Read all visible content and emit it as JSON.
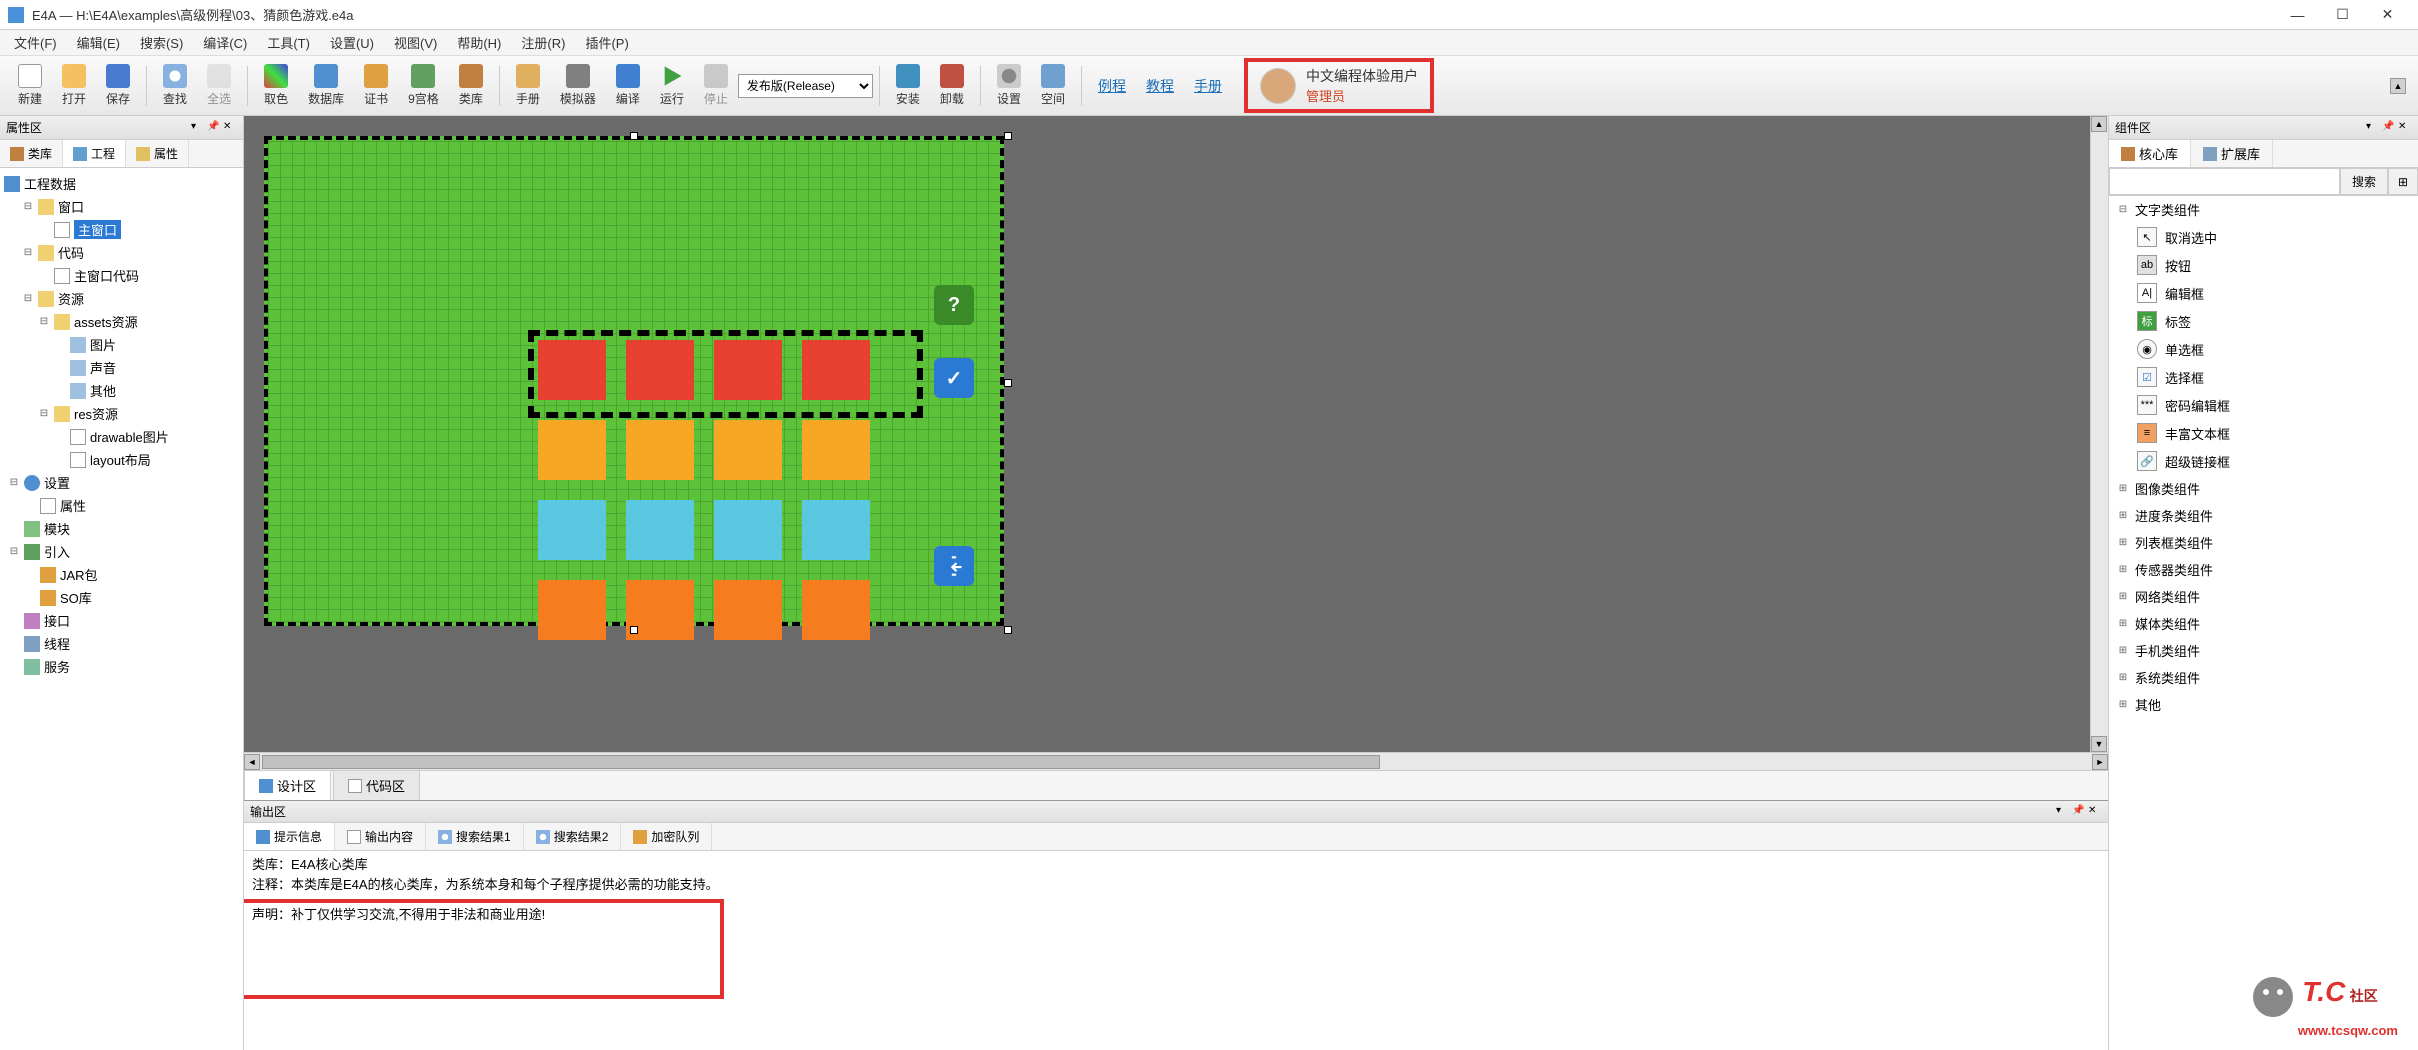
{
  "title": "E4A — H:\\E4A\\examples\\高级例程\\03、猜颜色游戏.e4a",
  "menu": [
    "文件(F)",
    "编辑(E)",
    "搜索(S)",
    "编译(C)",
    "工具(T)",
    "设置(U)",
    "视图(V)",
    "帮助(H)",
    "注册(R)",
    "插件(P)"
  ],
  "toolbar": {
    "new": "新建",
    "open": "打开",
    "save": "保存",
    "find": "查找",
    "select_all": "全选",
    "color": "取色",
    "database": "数据库",
    "cert": "证书",
    "grid9": "9宫格",
    "lib": "类库",
    "manual": "手册",
    "emulator": "模拟器",
    "compile": "编译",
    "run": "运行",
    "stop": "停止",
    "combo": "发布版(Release)",
    "install": "安装",
    "uninstall": "卸载",
    "settings": "设置",
    "space": "空间",
    "link1": "例程",
    "link2": "教程",
    "link3": "手册"
  },
  "user": {
    "name": "中文编程体验用户",
    "role": "管理员"
  },
  "left": {
    "title": "属性区",
    "tabs": [
      "类库",
      "工程",
      "属性"
    ],
    "tree": {
      "root": "工程数据",
      "window": "窗口",
      "main_window": "主窗口",
      "code": "代码",
      "main_window_code": "主窗口代码",
      "res": "资源",
      "assets": "assets资源",
      "pic": "图片",
      "sound": "声音",
      "other": "其他",
      "res2": "res资源",
      "drawable": "drawable图片",
      "layout": "layout布局",
      "settings": "设置",
      "props": "属性",
      "module": "模块",
      "import": "引入",
      "jar": "JAR包",
      "so": "SO库",
      "interface": "接口",
      "thread": "线程",
      "service": "服务"
    }
  },
  "center": {
    "design_tab": "设计区",
    "code_tab": "代码区",
    "btn_help": "?",
    "btn_check": "✓",
    "btn_exit": "exit"
  },
  "output": {
    "title": "输出区",
    "tabs": [
      "提示信息",
      "输出内容",
      "搜索结果1",
      "搜索结果2",
      "加密队列"
    ],
    "line1": "类库：E4A核心类库",
    "line2": "注释：本类库是E4A的核心类库，为系统本身和每个子程序提供必需的功能支持。",
    "line3": "声明：补丁仅供学习交流,不得用于非法和商业用途!"
  },
  "right": {
    "title": "组件区",
    "tabs": [
      "核心库",
      "扩展库"
    ],
    "search_btn": "搜索",
    "groups": {
      "text": "文字类组件",
      "items": [
        "取消选中",
        "按钮",
        "编辑框",
        "标签",
        "单选框",
        "选择框",
        "密码编辑框",
        "丰富文本框",
        "超级链接框"
      ],
      "image": "图像类组件",
      "progress": "进度条类组件",
      "list": "列表框类组件",
      "sensor": "传感器类组件",
      "network": "网络类组件",
      "media": "媒体类组件",
      "phone": "手机类组件",
      "system": "系统类组件",
      "other": "其他"
    }
  },
  "logo": {
    "tc": "T.C",
    "label": "社区",
    "url": "www.tcsqw.com"
  },
  "colors": {
    "red": "#e84030",
    "orange": "#f5a623",
    "blue": "#5ac8e0",
    "orange2": "#f57c1f",
    "green_btn": "#3a8a2a",
    "blue_btn": "#2a7ad4"
  }
}
